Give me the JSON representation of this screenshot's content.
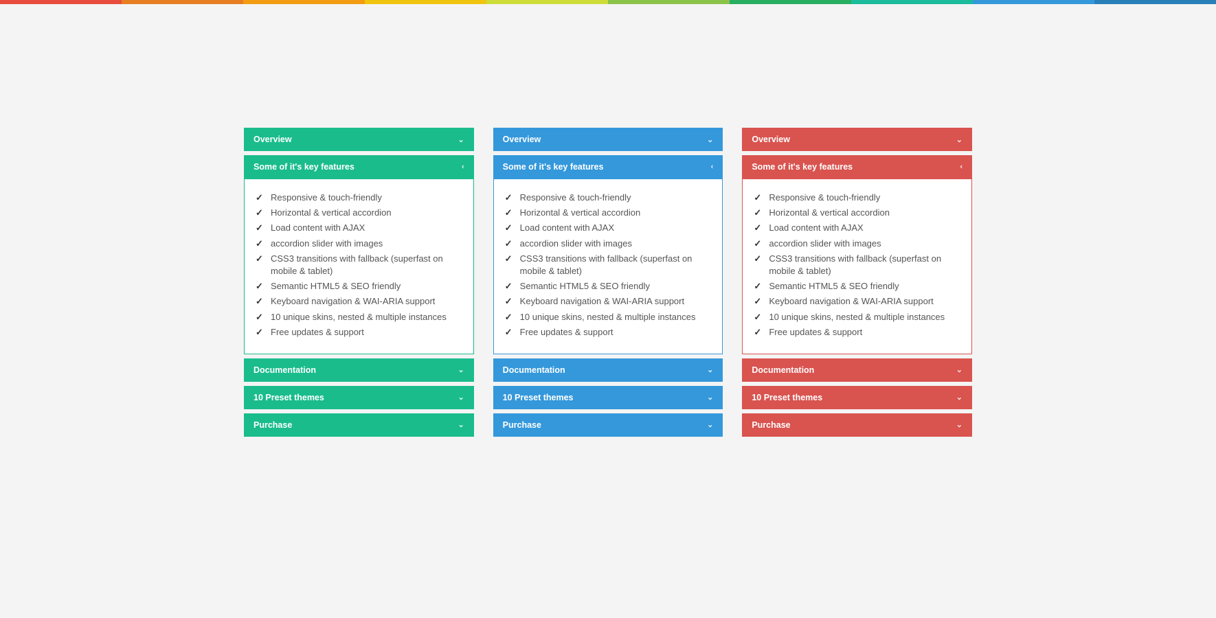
{
  "rainbow_colors": [
    "#e74c3c",
    "#e67e22",
    "#f39c12",
    "#f1c40f",
    "#cddc39",
    "#8bc34a",
    "#27ae60",
    "#1abc9c",
    "#3498db",
    "#2980b9"
  ],
  "themes": [
    {
      "id": "green",
      "label": "green"
    },
    {
      "id": "blue",
      "label": "blue"
    },
    {
      "id": "red",
      "label": "red"
    }
  ],
  "sections": [
    {
      "id": "overview",
      "label": "Overview",
      "expanded": false
    },
    {
      "id": "features",
      "label": "Some of it's key features",
      "expanded": true
    },
    {
      "id": "documentation",
      "label": "Documentation",
      "expanded": false
    },
    {
      "id": "themes",
      "label": "10 Preset themes",
      "expanded": false
    },
    {
      "id": "purchase",
      "label": "Purchase",
      "expanded": false
    }
  ],
  "features": [
    "Responsive & touch-friendly",
    "Horizontal & vertical accordion",
    "Load content with AJAX",
    "accordion slider with images",
    "CSS3 transitions with fallback (superfast on mobile & tablet)",
    "Semantic HTML5 & SEO friendly",
    "Keyboard navigation & WAI-ARIA support",
    "10 unique skins, nested & multiple instances",
    "Free updates & support"
  ],
  "icons": {
    "chevron_down": "⌄",
    "chevron_left": "‹",
    "check": "✓"
  }
}
